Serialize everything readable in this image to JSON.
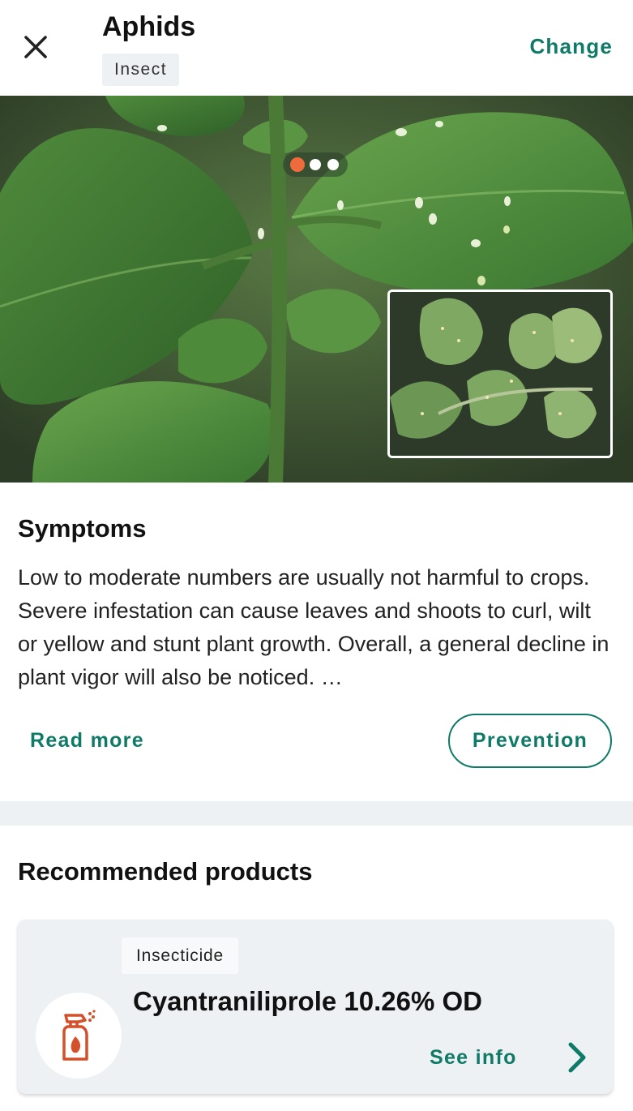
{
  "header": {
    "title": "Aphids",
    "type_badge": "Insect",
    "change_label": "Change"
  },
  "gallery": {
    "total_images": 3,
    "active_index": 0
  },
  "symptoms": {
    "heading": "Symptoms",
    "body": "Low to moderate numbers are usually not harmful to crops. Severe infestation can cause leaves and shoots to curl, wilt or yellow and stunt plant growth. Overall, a general decline in plant vigor will also be noticed. …",
    "read_more_label": "Read more",
    "prevention_label": "Prevention"
  },
  "recommended": {
    "heading": "Recommended products",
    "products": [
      {
        "category": "Insecticide",
        "name": "Cyantraniliprole 10.26% OD",
        "see_info_label": "See info",
        "icon": "spray-bottle-icon"
      }
    ]
  },
  "colors": {
    "accent": "#0f7a67",
    "active_dot": "#ef6b3b",
    "product_icon": "#d4502a",
    "surface": "#eef1f3"
  }
}
